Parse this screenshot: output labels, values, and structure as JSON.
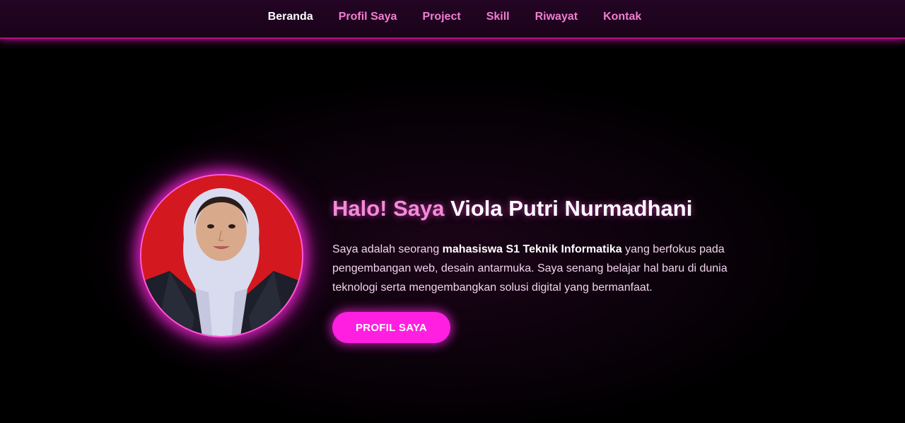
{
  "nav": {
    "items": [
      {
        "label": "Beranda",
        "active": true
      },
      {
        "label": "Profil Saya",
        "active": false
      },
      {
        "label": "Project",
        "active": false
      },
      {
        "label": "Skill",
        "active": false
      },
      {
        "label": "Riwayat",
        "active": false
      },
      {
        "label": "Kontak",
        "active": false
      }
    ]
  },
  "hero": {
    "greeting": "Halo! Saya ",
    "name": "Viola Putri Nurmadhani",
    "desc_pre": "Saya adalah seorang ",
    "desc_bold": "mahasiswa S1 Teknik Informatika",
    "desc_post": " yang berfokus pada pengembangan web, desain antarmuka. Saya senang belajar hal baru di dunia teknologi serta mengembangkan solusi digital yang bermanfaat.",
    "button_label": "PROFIL SAYA"
  },
  "colors": {
    "accent": "#ff1fe0",
    "nav_text": "#f27dd0",
    "greeting": "#f58ad9",
    "background": "#000000",
    "photo_background": "#d3191f"
  }
}
